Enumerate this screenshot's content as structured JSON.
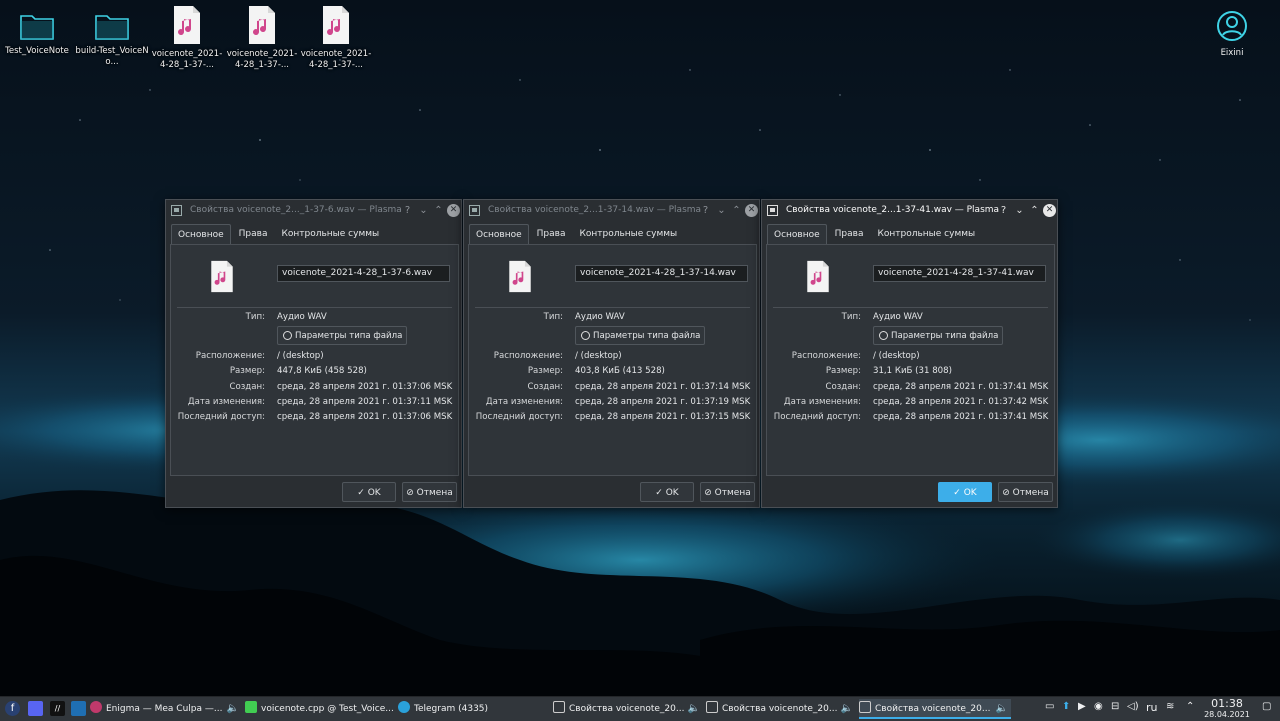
{
  "desktop": {
    "icons": [
      {
        "label": "Test_VoiceNote",
        "kind": "folder"
      },
      {
        "label": "build-Test_VoiceNo...",
        "kind": "folder"
      },
      {
        "label": "voicenote_2021-4-28_1-37-...",
        "kind": "audio"
      },
      {
        "label": "voicenote_2021-4-28_1-37-...",
        "kind": "audio"
      },
      {
        "label": "voicenote_2021-4-28_1-37-...",
        "kind": "audio"
      }
    ],
    "user": {
      "label": "Eixini"
    }
  },
  "colors": {
    "accent": "#3daee9",
    "window_bg": "#2a2e32",
    "panel_bg": "#2f3439",
    "taskbar_bg": "#31363b"
  },
  "dialog_common": {
    "tabs": [
      "Основное",
      "Права",
      "Контрольные суммы"
    ],
    "labels": {
      "type": "Тип:",
      "location": "Расположение:",
      "size": "Размер:",
      "created": "Создан:",
      "modified": "Дата изменения:",
      "accessed": "Последний доступ:"
    },
    "filetype_button": "Параметры типа файла",
    "ok": "OK",
    "cancel": "Отмена",
    "titlebar_buttons": {
      "help": "?",
      "minimize": "⌄",
      "maximize": "⌃",
      "close": "✕"
    }
  },
  "dialogs": [
    {
      "title": "Свойства voicenote_2..._1-37-6.wav — Plasma",
      "filename": "voicenote_2021-4-28_1-37-6.wav",
      "type": "Аудио WAV",
      "location": "/ (desktop)",
      "size": "447,8 КиБ (458 528)",
      "created": "среда, 28 апреля 2021 г. 01:37:06 MSK",
      "modified": "среда, 28 апреля 2021 г. 01:37:11 MSK",
      "accessed": "среда, 28 апреля 2021 г. 01:37:06 MSK",
      "active": false
    },
    {
      "title": "Свойства voicenote_2...1-37-14.wav — Plasma",
      "filename": "voicenote_2021-4-28_1-37-14.wav",
      "type": "Аудио WAV",
      "location": "/ (desktop)",
      "size": "403,8 КиБ (413 528)",
      "created": "среда, 28 апреля 2021 г. 01:37:14 MSK",
      "modified": "среда, 28 апреля 2021 г. 01:37:19 MSK",
      "accessed": "среда, 28 апреля 2021 г. 01:37:15 MSK",
      "active": false
    },
    {
      "title": "Свойства voicenote_2...1-37-41.wav — Plasma",
      "filename": "voicenote_2021-4-28_1-37-41.wav",
      "type": "Аудио WAV",
      "location": "/ (desktop)",
      "size": "31,1 КиБ (31 808)",
      "created": "среда, 28 апреля 2021 г. 01:37:41 MSK",
      "modified": "среда, 28 апреля 2021 г. 01:37:42 MSK",
      "accessed": "среда, 28 апреля 2021 г. 01:37:41 MSK",
      "active": true
    }
  ],
  "taskbar": {
    "launchers": [
      "fedora-icon",
      "discord-icon",
      "jetbrains-icon",
      "vscode-icon"
    ],
    "tasks": [
      {
        "label": "Enigma — Mea Culpa —...",
        "icon": "music-player-icon"
      },
      {
        "label": "voicenote.cpp @ Test_Voice...",
        "icon": "qt-creator-icon"
      },
      {
        "label": "Telegram (4335)",
        "icon": "telegram-icon",
        "badge": "4335"
      },
      {
        "label": "Свойства voicenote_20...",
        "icon": "properties-icon"
      },
      {
        "label": "Свойства voicenote_20...",
        "icon": "properties-icon"
      },
      {
        "label": "Свойства voicenote_20...",
        "icon": "properties-icon"
      }
    ],
    "tray": {
      "language": "ru"
    },
    "clock": {
      "time": "01:38",
      "date": "28.04.2021"
    }
  }
}
